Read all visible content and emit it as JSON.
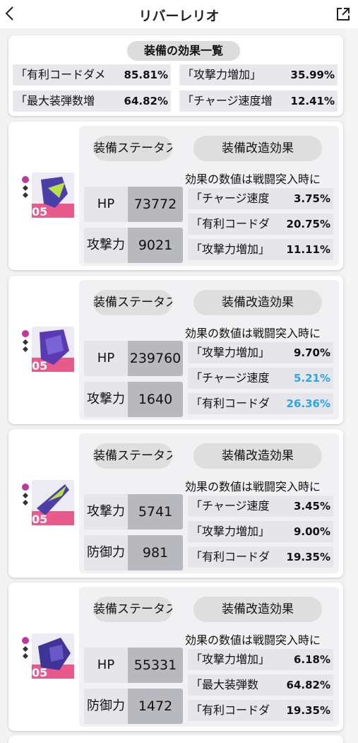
{
  "header": {
    "title": "リバーレリオ"
  },
  "summary": {
    "title": "装備の効果一覧",
    "items": [
      {
        "label": "「有利コードダメ",
        "value": "85.81%"
      },
      {
        "label": "「攻撃力増加」",
        "value": "35.99%"
      },
      {
        "label": "「最大装弾数増",
        "value": "64.82%"
      },
      {
        "label": "「チャージ速度増",
        "value": "12.41%"
      }
    ]
  },
  "equipment": [
    {
      "level": "05",
      "stat_tab": "装備ステータス",
      "mod_tab": "装備改造効果",
      "stats": [
        {
          "label": "HP",
          "value": "73772"
        },
        {
          "label": "攻撃力",
          "value": "9021"
        }
      ],
      "note": "効果の数値は戦闘突入時に",
      "mods": [
        {
          "label": "「チャージ速度",
          "value": "3.75%",
          "highlight": false
        },
        {
          "label": "「有利コードダ",
          "value": "20.75%",
          "highlight": false
        },
        {
          "label": "「攻撃力増加」",
          "value": "11.11%",
          "highlight": false
        }
      ]
    },
    {
      "level": "05",
      "stat_tab": "装備ステータス",
      "mod_tab": "装備改造効果",
      "stats": [
        {
          "label": "HP",
          "value": "239760"
        },
        {
          "label": "攻撃力",
          "value": "1640"
        }
      ],
      "note": "効果の数値は戦闘突入時に",
      "mods": [
        {
          "label": "「攻撃力増加」",
          "value": "9.70%",
          "highlight": false
        },
        {
          "label": "「チャージ速度",
          "value": "5.21%",
          "highlight": true
        },
        {
          "label": "「有利コードダ",
          "value": "26.36%",
          "highlight": true
        }
      ]
    },
    {
      "level": "05",
      "stat_tab": "装備ステータス",
      "mod_tab": "装備改造効果",
      "stats": [
        {
          "label": "攻撃力",
          "value": "5741"
        },
        {
          "label": "防御力",
          "value": "981"
        }
      ],
      "note": "効果の数値は戦闘突入時に",
      "mods": [
        {
          "label": "「チャージ速度",
          "value": "3.45%",
          "highlight": false
        },
        {
          "label": "「攻撃力増加」",
          "value": "9.00%",
          "highlight": false
        },
        {
          "label": "「有利コードダ",
          "value": "19.35%",
          "highlight": false
        }
      ]
    },
    {
      "level": "05",
      "stat_tab": "装備ステータス",
      "mod_tab": "装備改造効果",
      "stats": [
        {
          "label": "HP",
          "value": "55331"
        },
        {
          "label": "防御力",
          "value": "1472"
        }
      ],
      "note": "効果の数値は戦闘突入時に",
      "mods": [
        {
          "label": "「攻撃力増加」",
          "value": "6.18%",
          "highlight": false
        },
        {
          "label": "「最大装弾数",
          "value": "64.82%",
          "highlight": false
        },
        {
          "label": "「有利コードダ",
          "value": "19.35%",
          "highlight": false
        }
      ]
    }
  ],
  "colors": {
    "accent_blue": "#2aa6e8",
    "rarity_pink": "#e8407a",
    "card_bg": "#ffffff"
  },
  "icons": {
    "back": "chevron-left-icon",
    "open": "external-link-icon"
  }
}
